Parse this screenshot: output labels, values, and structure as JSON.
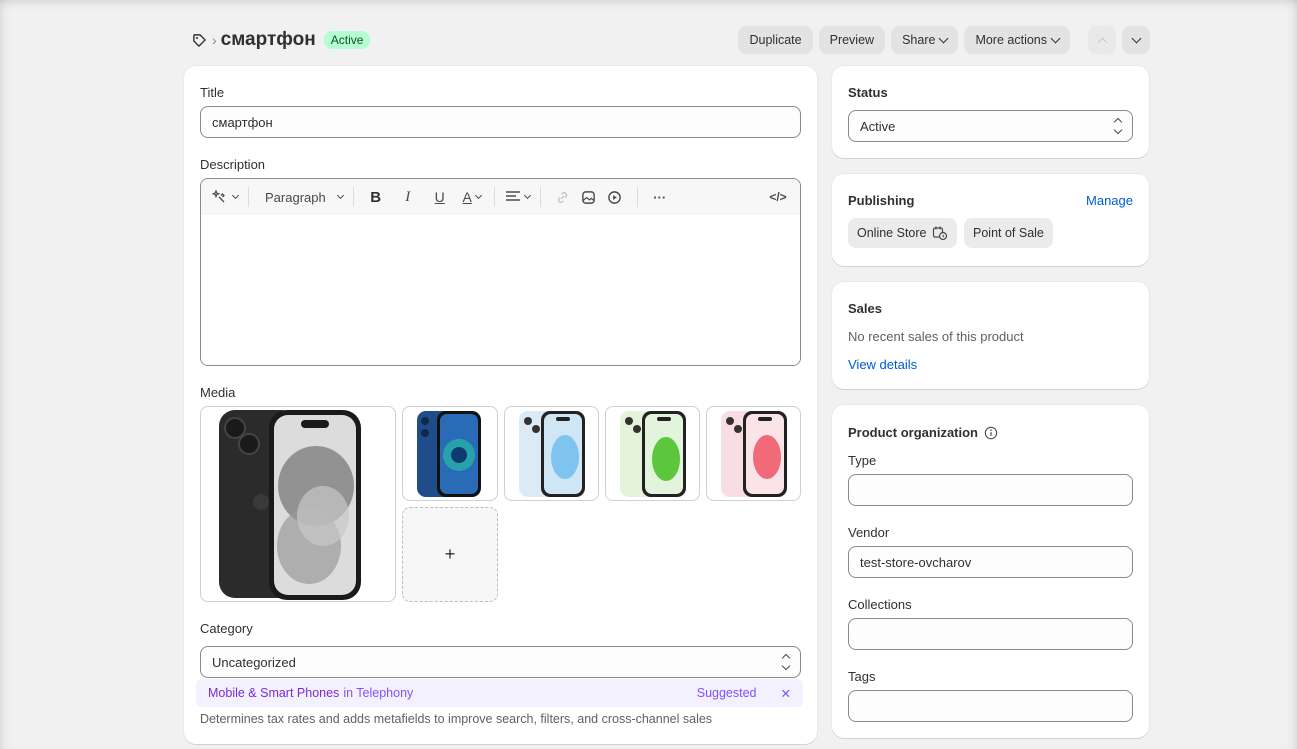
{
  "header": {
    "title": "смартфон",
    "status_badge": "Active",
    "actions": {
      "duplicate": "Duplicate",
      "preview": "Preview",
      "share": "Share",
      "more": "More actions"
    }
  },
  "main": {
    "title_label": "Title",
    "title_value": "смартфон",
    "description_label": "Description",
    "toolbar": {
      "paragraph": "Paragraph",
      "bold": "B",
      "italic": "I",
      "underline": "U",
      "color": "A",
      "more": "···",
      "code": "</>"
    },
    "media_label": "Media",
    "add_media": "+",
    "category_label": "Category",
    "category_value": "Uncategorized",
    "suggestion": {
      "category": "Mobile & Smart Phones",
      "in_text": "in Telephony",
      "tag": "Suggested",
      "dismiss": "✕"
    },
    "category_help": "Determines tax rates and adds metafields to improve search, filters, and cross-channel sales"
  },
  "side": {
    "status_label": "Status",
    "status_value": "Active",
    "publishing_label": "Publishing",
    "manage": "Manage",
    "channels": [
      "Online Store",
      "Point of Sale"
    ],
    "sales_label": "Sales",
    "sales_text": "No recent sales of this product",
    "view_details": "View details",
    "org_label": "Product organization",
    "type_label": "Type",
    "type_value": "",
    "vendor_label": "Vendor",
    "vendor_value": "test-store-ovcharov",
    "collections_label": "Collections",
    "collections_value": "",
    "tags_label": "Tags",
    "tags_value": ""
  },
  "colors": {
    "accent_link": "#005bd3",
    "badge_bg": "#b4fed2",
    "suggest_purple": "#7a2bd6",
    "phone_colors": [
      "#2b2b2b",
      "#1f4d8c",
      "#a9d3ee",
      "#a6e08a",
      "#f5a3b3"
    ]
  },
  "icons": {
    "breadcrumb": "tag-icon",
    "ai": "magic-icon",
    "link": "link-icon",
    "image": "image-icon",
    "video": "video-icon",
    "info": "info-icon",
    "schedule": "calendar-clock-icon"
  }
}
